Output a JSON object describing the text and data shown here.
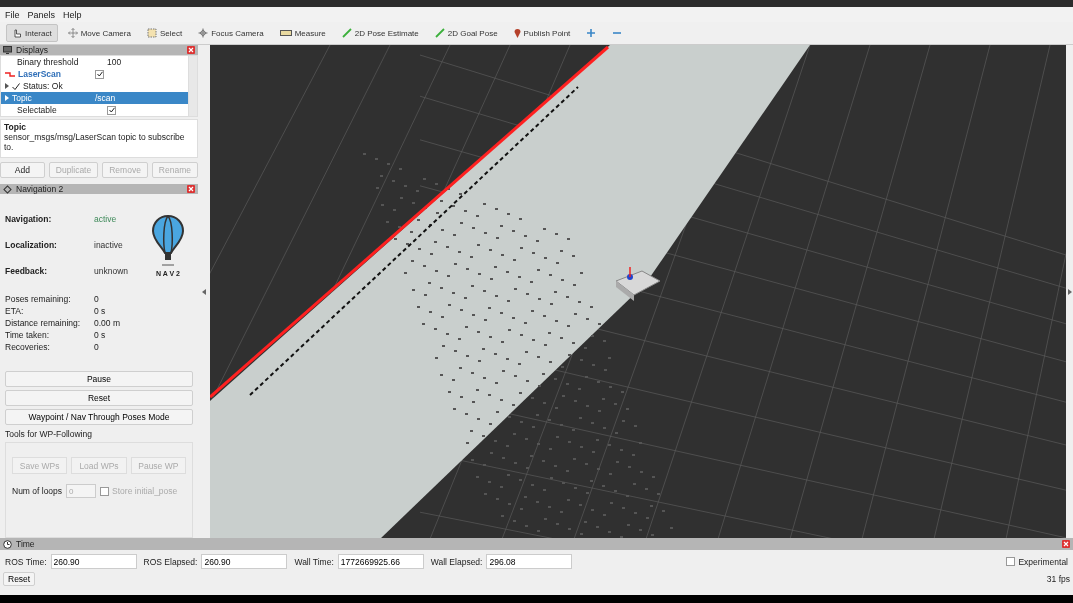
{
  "menu": [
    {
      "label": "File"
    },
    {
      "label": "Panels"
    },
    {
      "label": "Help"
    }
  ],
  "toolbar": [
    {
      "kind": "interact",
      "label": "Interact",
      "selected": true
    },
    {
      "kind": "move",
      "label": "Move Camera",
      "selected": false
    },
    {
      "kind": "select",
      "label": "Select",
      "selected": false
    },
    {
      "kind": "focus",
      "label": "Focus Camera",
      "selected": false
    },
    {
      "kind": "measure",
      "label": "Measure",
      "selected": false
    },
    {
      "kind": "pose",
      "label": "2D Pose Estimate",
      "selected": false
    },
    {
      "kind": "pose",
      "label": "2D Goal Pose",
      "selected": false
    },
    {
      "kind": "point",
      "label": "Publish Point",
      "selected": false
    },
    {
      "kind": "plus",
      "selected": false
    },
    {
      "kind": "minus",
      "selected": false
    }
  ],
  "displays": {
    "title": "Displays",
    "rows": [
      {
        "kind": "property",
        "label": "Binary threshold",
        "value": "100",
        "selected": false
      },
      {
        "kind": "display",
        "label": "LaserScan",
        "checked": true,
        "selected": false
      },
      {
        "kind": "status",
        "label": "Status: Ok",
        "selected": false
      },
      {
        "kind": "branch",
        "label": "Topic",
        "value": "/scan",
        "selected": true
      },
      {
        "kind": "check",
        "label": "Selectable",
        "checked": true,
        "selected": false
      }
    ],
    "description": {
      "title": "Topic",
      "text": "sensor_msgs/msg/LaserScan topic to subscribe to."
    },
    "buttons": [
      {
        "label": "Add",
        "disabled": false
      },
      {
        "label": "Duplicate",
        "disabled": true
      },
      {
        "label": "Remove",
        "disabled": true
      },
      {
        "label": "Rename",
        "disabled": true
      }
    ]
  },
  "navigation": {
    "title": "Navigation 2",
    "states": [
      {
        "label": "Navigation:",
        "value": "active",
        "active": true
      },
      {
        "label": "Localization:",
        "value": "inactive",
        "active": false
      },
      {
        "label": "Feedback:",
        "value": "unknown",
        "active": false
      }
    ],
    "logo_text": "N A V 2",
    "stats": [
      {
        "label": "Poses remaining:",
        "value": "0"
      },
      {
        "label": "ETA:",
        "value": "0 s"
      },
      {
        "label": "Distance remaining:",
        "value": "0.00 m"
      },
      {
        "label": "Time taken:",
        "value": "0 s"
      },
      {
        "label": "Recoveries:",
        "value": "0"
      }
    ],
    "buttons": [
      {
        "label": "Pause"
      },
      {
        "label": "Reset"
      },
      {
        "label": "Waypoint / Nav Through Poses Mode"
      }
    ],
    "wp_tools": {
      "title": "Tools for WP-Following",
      "buttons": [
        {
          "label": "Save WPs",
          "disabled": true
        },
        {
          "label": "Load WPs",
          "disabled": true
        },
        {
          "label": "Pause WP",
          "disabled": true
        }
      ],
      "loops_label": "Num of loops",
      "loops_value": "0",
      "store_label": "Store initial_pose",
      "store_checked": false
    }
  },
  "time": {
    "title": "Time",
    "fields": [
      {
        "label": "ROS Time:",
        "value": "260.90"
      },
      {
        "label": "ROS Elapsed:",
        "value": "260.90"
      },
      {
        "label": "Wall Time:",
        "value": "1772669925.66"
      },
      {
        "label": "Wall Elapsed:",
        "value": "296.08"
      }
    ],
    "experimental_label": "Experimental",
    "experimental_checked": false,
    "reset": "Reset",
    "fps": "31 fps"
  }
}
